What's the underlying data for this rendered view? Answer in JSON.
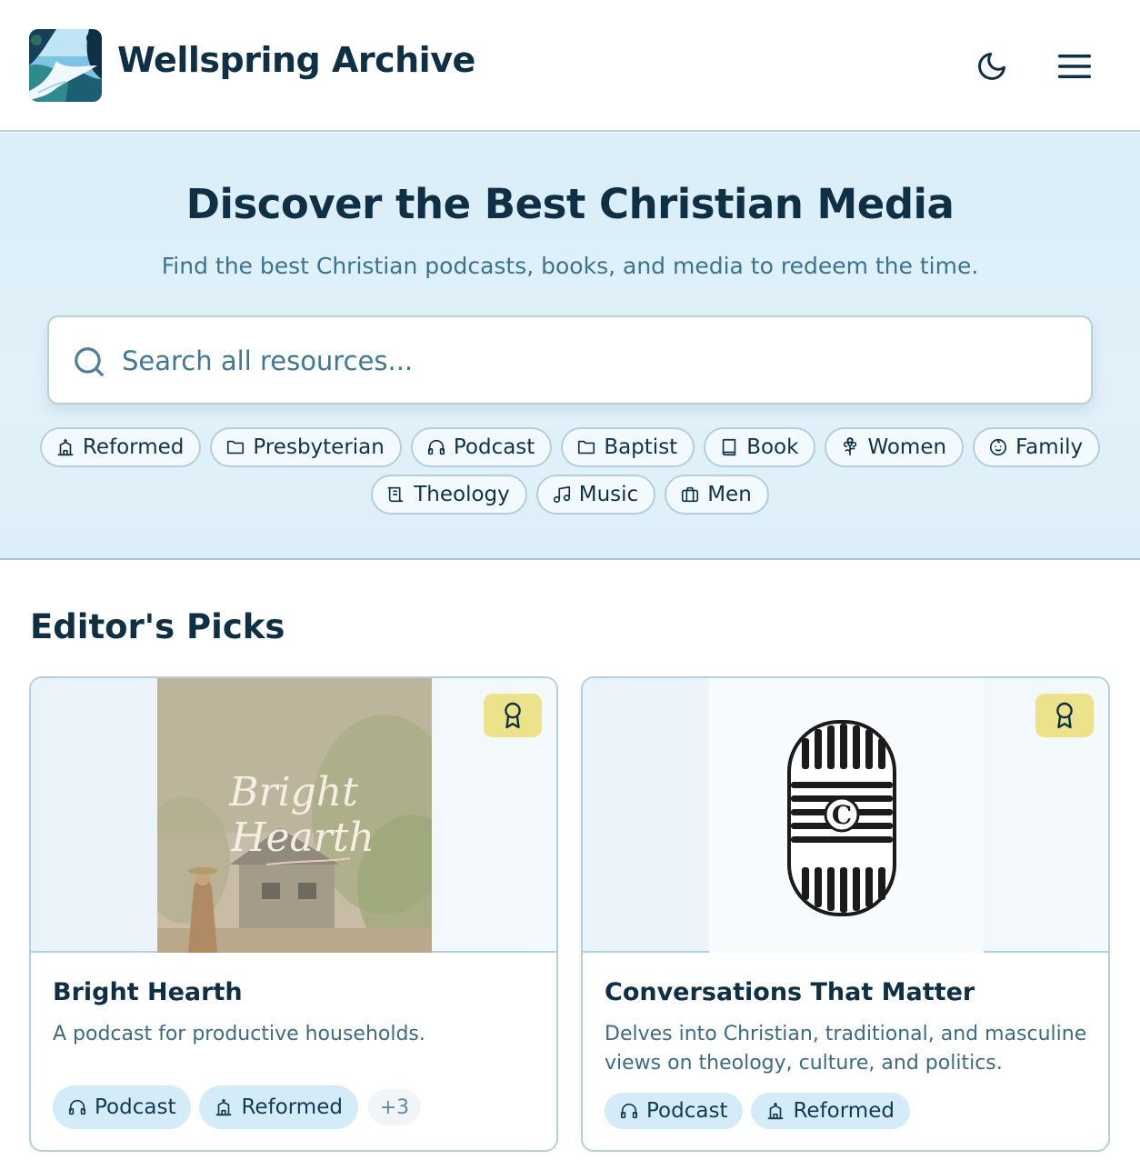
{
  "header": {
    "brand": "Wellspring Archive",
    "logo_icon": "waterfall-landscape-logo",
    "theme_toggle_icon": "moon-icon",
    "menu_icon": "hamburger-menu-icon"
  },
  "hero": {
    "title": "Discover the Best Christian Media",
    "subtitle": "Find the best Christian podcasts, books, and media to redeem the time.",
    "search": {
      "placeholder": "Search all resources...",
      "value": ""
    },
    "chips_row1": [
      {
        "label": "Reformed",
        "icon": "church-icon"
      },
      {
        "label": "Presbyterian",
        "icon": "folder-icon"
      },
      {
        "label": "Podcast",
        "icon": "headphones-icon"
      },
      {
        "label": "Baptist",
        "icon": "folder-icon"
      },
      {
        "label": "Book",
        "icon": "book-icon"
      },
      {
        "label": "Women",
        "icon": "flower-icon"
      },
      {
        "label": "Family",
        "icon": "baby-icon"
      }
    ],
    "chips_row2": [
      {
        "label": "Theology",
        "icon": "scroll-icon"
      },
      {
        "label": "Music",
        "icon": "music-note-icon"
      },
      {
        "label": "Men",
        "icon": "briefcase-icon"
      }
    ]
  },
  "picks": {
    "title": "Editor's Picks",
    "cards": [
      {
        "title": "Bright Hearth",
        "description": "A podcast for productive households.",
        "cover_script": "Bright Hearth",
        "badge_icon": "award-ribbon-icon",
        "tags": [
          {
            "label": "Podcast",
            "icon": "headphones-icon"
          },
          {
            "label": "Reformed",
            "icon": "church-icon"
          }
        ],
        "more": "+3"
      },
      {
        "title": "Conversations That Matter",
        "description": "Delves into Christian, traditional, and masculine views on theology, culture, and politics.",
        "badge_icon": "award-ribbon-icon",
        "tags": [
          {
            "label": "Podcast",
            "icon": "headphones-icon"
          },
          {
            "label": "Reformed",
            "icon": "church-icon"
          }
        ]
      }
    ]
  },
  "colors": {
    "primary_text": "#0f2f45",
    "accent_text": "#3a7491",
    "hero_bg": "#dceef8",
    "badge": "#ece28a",
    "tag_bg": "#d4ecf8"
  }
}
